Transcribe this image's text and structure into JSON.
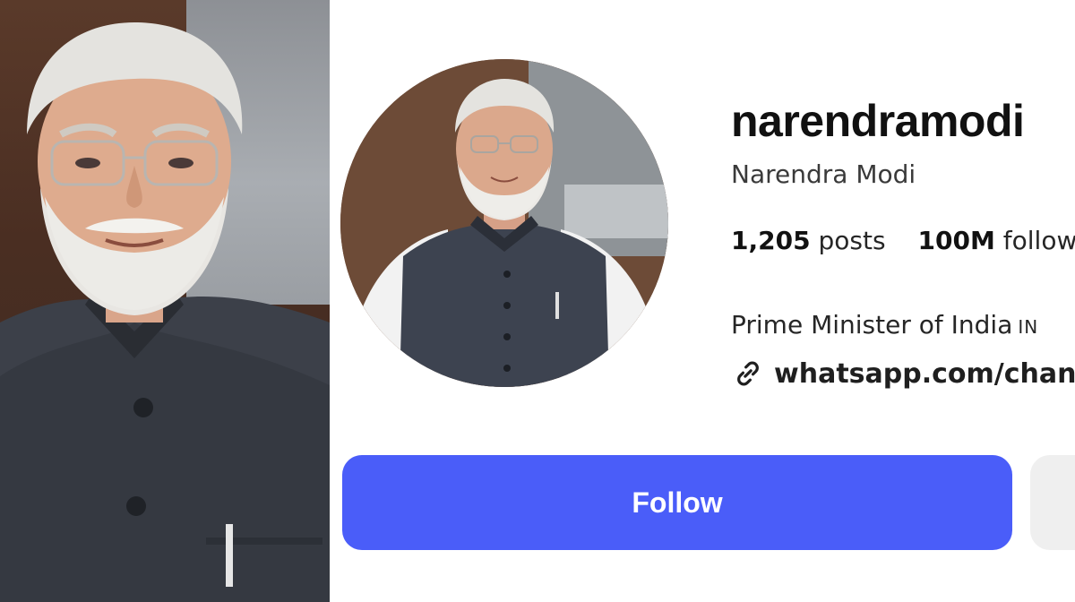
{
  "profile": {
    "username": "narendramodi",
    "full_name": "Narendra Modi",
    "stats": {
      "posts_count": "1,205",
      "posts_label": "posts",
      "followers_count": "100M",
      "followers_label": "follow"
    },
    "bio": "Prime Minister of India",
    "bio_flag": "IN",
    "link_text": "whatsapp.com/channe",
    "link_icon": "link-icon"
  },
  "actions": {
    "follow_label": "Follow"
  },
  "colors": {
    "accent": "#4a5df9",
    "secondary_button": "#efefef"
  }
}
